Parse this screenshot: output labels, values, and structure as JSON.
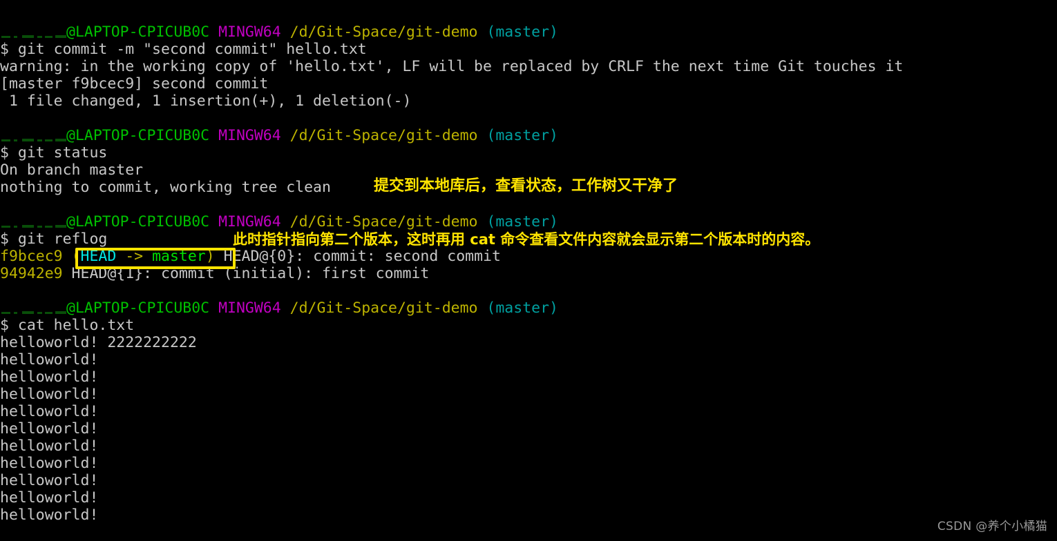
{
  "terminal": {
    "app": "MINGW64 Git Bash",
    "background_color": "#000000",
    "foreground_color": "#c8c8c8",
    "colors": {
      "user_host_green": "#00c000",
      "mingw_purple": "#c000c0",
      "path_yellow": "#bdb300",
      "branch_cyan": "#00a0a0",
      "hash_yellow": "#bdb300",
      "head_cyan": "#00e5e5",
      "master_green": "#00e000",
      "annotation_yellow": "#ffe400",
      "highlight_box_yellow": "#ffe400"
    },
    "prompt": {
      "user": "",
      "at": "@",
      "host": "LAPTOP-CPICUB0C",
      "shell": "MINGW64",
      "path": "/d/Git-Space/git-demo",
      "branch": "(master)",
      "dollar": "$"
    },
    "blocks": [
      {
        "command": "git commit -m \"second commit\" hello.txt",
        "output": [
          "warning: in the working copy of 'hello.txt', LF will be replaced by CRLF the next time Git touches it",
          "[master f9bcec9] second commit",
          " 1 file changed, 1 insertion(+), 1 deletion(-)"
        ]
      },
      {
        "command": "git status",
        "output": [
          "On branch master",
          "nothing to commit, working tree clean"
        ]
      },
      {
        "command": "git reflog",
        "output": [
          "f9bcec9 (HEAD -> master) HEAD@{0}: commit: second commit",
          "94942e9 HEAD@{1}: commit (initial): first commit"
        ]
      },
      {
        "command": "cat hello.txt",
        "output": [
          "helloworld! 2222222222",
          "helloworld!",
          "helloworld!",
          "helloworld!",
          "helloworld!",
          "helloworld!",
          "helloworld!",
          "helloworld!",
          "helloworld!",
          "helloworld!",
          "helloworld!"
        ]
      }
    ],
    "reflog": {
      "entry0": {
        "hash": "f9bcec9",
        "open_paren": "(",
        "head": "HEAD",
        "arrow": " -> ",
        "master": "master",
        "close_paren": ")",
        "rest": " HEAD@{0}: commit: second commit"
      },
      "entry1": {
        "hash": "94942e9",
        "rest": " HEAD@{1}: commit (initial): first commit"
      }
    },
    "commit_output": {
      "warning": "warning: in the working copy of 'hello.txt', LF will be replaced by CRLF the next time Git touches it",
      "commit_line": "[master f9bcec9] second commit",
      "stats_line": " 1 file changed, 1 insertion(+), 1 deletion(-)"
    },
    "status_output": {
      "branch_line": "On branch master",
      "clean_line": "nothing to commit, working tree clean"
    },
    "commands": {
      "commit": "$ git commit -m \"second commit\" hello.txt",
      "status": "$ git status",
      "reflog": "$ git reflog",
      "cat": "$ cat hello.txt"
    },
    "cat_output": {
      "line1": "helloworld! 2222222222",
      "line2": "helloworld!",
      "line3": "helloworld!",
      "line4": "helloworld!",
      "line5": "helloworld!",
      "line6": "helloworld!",
      "line7": "helloworld!",
      "line8": "helloworld!",
      "line9": "helloworld!",
      "line10": "helloworld!",
      "line11": "helloworld!"
    }
  },
  "annotations": {
    "status_note": "提交到本地库后，查看状态，工作树又干净了",
    "reflog_note": "此时指针指向第二个版本，这时再用 cat 命令查看文件内容就会显示第二个版本时的内容。"
  },
  "watermark": {
    "text": "CSDN @养个小橘猫"
  }
}
